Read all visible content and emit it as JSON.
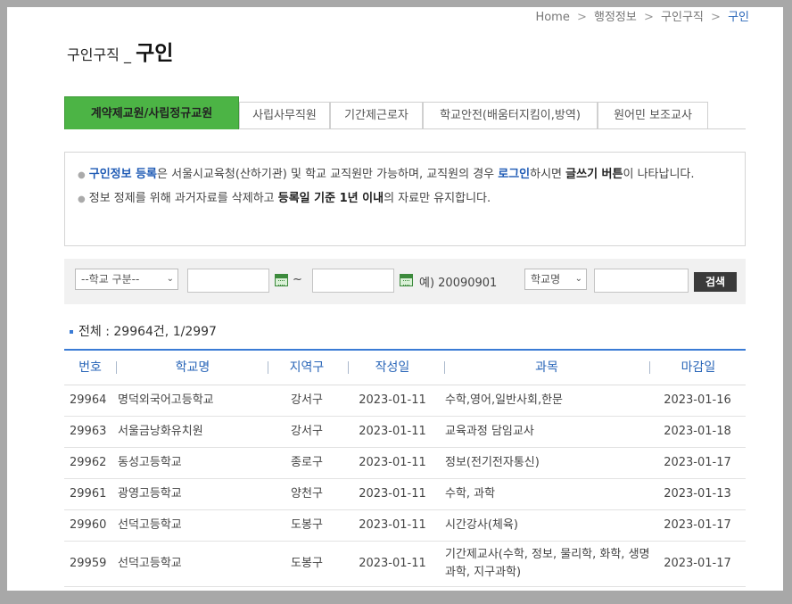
{
  "breadcrumb": {
    "home": "Home",
    "sep": ">",
    "level1": "행정정보",
    "level2": "구인구직",
    "current": "구인"
  },
  "title": {
    "prefix": "구인구직 _",
    "main": "구인"
  },
  "tabs": [
    {
      "label": "계약제교원/사립정규교원",
      "active": true
    },
    {
      "label": "사립사무직원",
      "active": false
    },
    {
      "label": "기간제근로자",
      "active": false
    },
    {
      "label": "학교안전(배움터지킴이,방역)",
      "active": false
    },
    {
      "label": "원어민 보조교사",
      "active": false
    }
  ],
  "notice": {
    "line1_a": "구인정보 등록",
    "line1_b": "은 서울시교육청(산하기관) 및 학교 교직원만 가능하며, 교직원의 경우 ",
    "line1_c": "로그인",
    "line1_d": "하시면 ",
    "line1_e": "글쓰기 버튼",
    "line1_f": "이 나타납니다.",
    "line2_a": "정보 정제를 위해 과거자료를 삭제하고 ",
    "line2_b": "등록일 기준 1년 이내",
    "line2_c": "의 자료만 유지합니다."
  },
  "search": {
    "school_type_selected": "--학교 구분--",
    "date_from": "",
    "date_to": "",
    "range_sep": "~",
    "date_example": "예) 20090901",
    "field_selected": "학교명",
    "keyword": "",
    "button_label": "검색"
  },
  "summary": {
    "text": "전체 : 29964건, 1/2997"
  },
  "table": {
    "headers": {
      "num": "번호",
      "school": "학교명",
      "area": "지역구",
      "date": "작성일",
      "subject": "과목",
      "deadline": "마감일"
    },
    "rows": [
      {
        "num": "29964",
        "school": "명덕외국어고등학교",
        "area": "강서구",
        "date": "2023-01-11",
        "subject": "수학,영어,일반사회,한문",
        "deadline": "2023-01-16"
      },
      {
        "num": "29963",
        "school": "서울금낭화유치원",
        "area": "강서구",
        "date": "2023-01-11",
        "subject": "교육과정 담임교사",
        "deadline": "2023-01-18"
      },
      {
        "num": "29962",
        "school": "동성고등학교",
        "area": "종로구",
        "date": "2023-01-11",
        "subject": "정보(전기전자통신)",
        "deadline": "2023-01-17"
      },
      {
        "num": "29961",
        "school": "광영고등학교",
        "area": "양천구",
        "date": "2023-01-11",
        "subject": "수학, 과학",
        "deadline": "2023-01-13"
      },
      {
        "num": "29960",
        "school": "선덕고등학교",
        "area": "도봉구",
        "date": "2023-01-11",
        "subject": "시간강사(체육)",
        "deadline": "2023-01-17"
      },
      {
        "num": "29959",
        "school": "선덕고등학교",
        "area": "도봉구",
        "date": "2023-01-11",
        "subject": "기간제교사(수학, 정보, 물리학, 화학, 생명과학, 지구과학)",
        "deadline": "2023-01-17"
      }
    ]
  }
}
